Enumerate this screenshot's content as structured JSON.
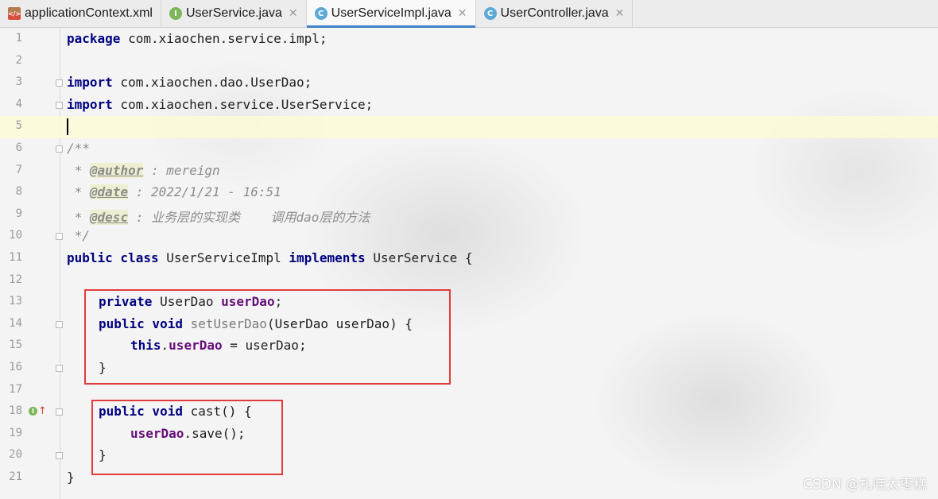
{
  "tabs": [
    {
      "label": "applicationContext.xml",
      "icon": "xml-file-icon",
      "active": false
    },
    {
      "label": "UserService.java",
      "icon": "interface-icon",
      "icon_letter": "I",
      "active": false
    },
    {
      "label": "UserServiceImpl.java",
      "icon": "class-icon",
      "icon_letter": "C",
      "active": true
    },
    {
      "label": "UserController.java",
      "icon": "class-icon",
      "icon_letter": "C",
      "active": false
    }
  ],
  "close_glyph": "✕",
  "line_numbers": [
    "1",
    "2",
    "3",
    "4",
    "5",
    "6",
    "7",
    "8",
    "9",
    "10",
    "11",
    "12",
    "13",
    "14",
    "15",
    "16",
    "17",
    "18",
    "19",
    "20",
    "21"
  ],
  "code": {
    "l1": {
      "kw": "package",
      "rest": " com.xiaochen.service.impl;"
    },
    "l3": {
      "kw": "import",
      "rest": " com.xiaochen.dao.UserDao;"
    },
    "l4": {
      "kw": "import",
      "rest": " com.xiaochen.service.UserService;"
    },
    "l6": "/**",
    "l7": {
      "star": " * ",
      "tag": "@author",
      "rest": " : mereign"
    },
    "l8": {
      "star": " * ",
      "tag": "@date",
      "rest": " : 2022/1/21 - 16:51"
    },
    "l9": {
      "star": " * ",
      "tag": "@desc",
      "rest": " : 业务层的实现类    调用dao层的方法"
    },
    "l10": " */",
    "l11": {
      "kw": "public class",
      "name": " UserServiceImpl ",
      "kw2": "implements",
      "rest": " UserService {"
    },
    "l13": {
      "kw": "private",
      "type": " UserDao ",
      "field": "userDao",
      "rest": ";"
    },
    "l14": {
      "kw": "public void",
      "method": " setUserDao",
      "rest": "(UserDao userDao) {"
    },
    "l15": {
      "kw": "this",
      "dot": ".",
      "field": "userDao",
      "rest": " = userDao;"
    },
    "l16": "}",
    "l18": {
      "kw": "public void",
      "rest": " cast() {"
    },
    "l19": {
      "field": "userDao",
      "rest": ".save();"
    },
    "l20": "}",
    "l21": "}"
  },
  "gutter_marker_letter": "I",
  "gutter_marker_arrow": "↑",
  "watermark": "CSDN @扎哇太枣糕",
  "colors": {
    "keyword": "#000080",
    "field": "#660e7a",
    "comment": "#8c8c8c",
    "highlight_box": "#e23b3b",
    "current_line": "#fcfad6",
    "active_tab_underline": "#4083c9"
  }
}
